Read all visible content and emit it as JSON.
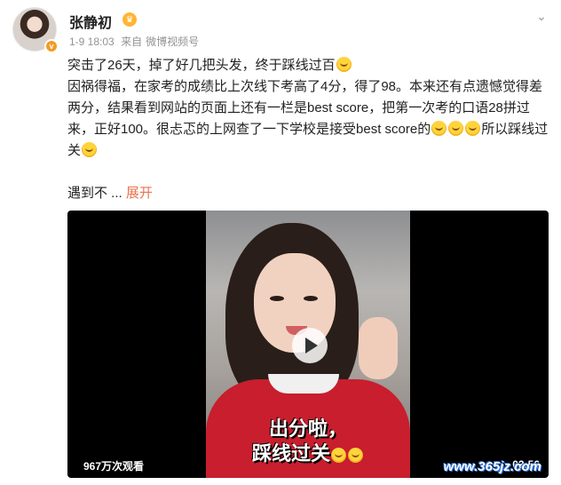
{
  "post": {
    "username": "张静初",
    "date": "1-9 18:03",
    "source_prefix": "来自",
    "source": "微博视频号",
    "paragraph1": "突击了26天，掉了好几把头发，终于踩线过百",
    "paragraph2a": "因祸得福，在家考的成绩比上次线下考高了4分，得了98。本来还有点遗憾觉得差两分，结果看到网站的页面上还有一栏是best score，把第一次考的口语28拼过来，正好100。很忐忑的上网查了一下学校是接受best score的",
    "paragraph2b": "所以踩线过关",
    "short_line": "遇到不 ...",
    "expand_label": "展开"
  },
  "video": {
    "caption_line1": "出分啦，",
    "caption_line2": "踩线过关",
    "views": "967万次观看",
    "duration": "03:56"
  },
  "watermark": "www.365jz.com",
  "colors": {
    "link": "#eb7350",
    "meta": "#939393",
    "verified": "#f59b22"
  },
  "icons": [
    "verified-badge-icon",
    "vip-crown-icon",
    "chevron-down-icon",
    "grin-emoji-icon",
    "play-icon"
  ]
}
